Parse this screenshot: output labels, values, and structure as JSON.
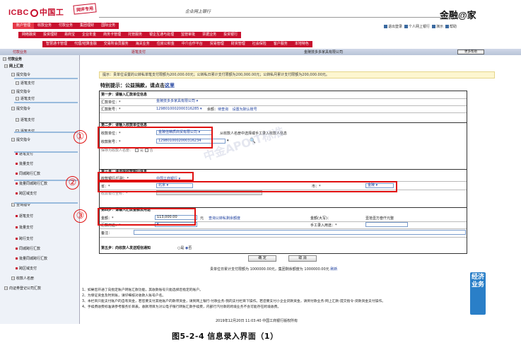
{
  "header": {
    "logo_text": "ICBC",
    "logo_cn": "中国工",
    "stamp": "网评专用",
    "ebank_title": "企业网上银行",
    "brand": "金融@家"
  },
  "menu_row1": [
    "账户管理",
    "收款业务",
    "付款业务",
    "集团理财",
    "国际业务"
  ],
  "menu_row2": [
    "网络融资",
    "投资理财",
    "易商宝",
    "企业年金",
    "商务卡管理",
    "托管服务",
    "银企互通与处理",
    "监管审批",
    "票据业务",
    "投资银行"
  ],
  "menu_row3": [
    "智慧通卡管理",
    "代理/结算金融",
    "交易所会员服务",
    "海关业务",
    "住房公积金",
    "中介合作平台",
    "贸易管理",
    "财资管理",
    "社会保险",
    "客户服务",
    "本地特色"
  ],
  "top_links": [
    "退出登录",
    "个人网上银行",
    "演示",
    "帮助"
  ],
  "navbar": {
    "left": "付款业务",
    "center": "逐笔支付",
    "company": "金陵技多多家具有限公司",
    "more_button": "更多帮助"
  },
  "sidebar": {
    "items": [
      "付款业务",
      "网上汇款",
      "提交指令",
      "逐笔支付",
      "提交指令",
      "逐笔支付",
      "提交指令",
      "逐笔支付",
      "逐笔支付",
      "提交指令",
      "逐笔支付",
      "批量支付",
      "同城跨行汇款",
      "批量同城跨行汇款",
      "跨区域支付",
      "查询指令",
      "逐笔支付",
      "批量支付",
      "跨行支付",
      "同城跨行汇款",
      "批量同城跨行汇款",
      "跨区域支付",
      "收款人名册",
      "向证券登记公司汇款"
    ]
  },
  "tip": "提示：贵单位设置的公转私单笔支付限额为200,000.00元；公转私日累计支付限额为200,000.00元；公转私月累计支付限额为200,000.00元。",
  "special": {
    "prefix": "特别提示：公益捐款，请点击",
    "link": "这里"
  },
  "form": {
    "step1": "第一步：请输入汇款单位信息",
    "payer_label": "汇款单位：*",
    "payer_value": "金陵技多多家具有限公司",
    "payer_account_label": "汇款账号：*",
    "payer_account_value": "1298010002000316285",
    "balance_label": "余额：",
    "balance_link": "待查询",
    "default_link": "设置为默认账号",
    "step2": "第二步：请输入收款单位信息",
    "payee_label": "收款单位：*",
    "payee_value": "金陵佳精质商贸有限公司",
    "payee_hint": "从收款人名册中选择或手工录入收款人信息",
    "payee_account_label": "收款账号：*",
    "payee_account_value": "1298010002000316234",
    "save_label": "保存为收款人名册：",
    "save_opts": [
      "是",
      "否"
    ],
    "step3": "第三步：请选择收款银行信息",
    "bank_label": "收款银行/行别：*",
    "bank_value": "中国工商银行",
    "province_label": "省：*",
    "province_value": "北京",
    "city_label": "市：*",
    "city_value": "金陵",
    "branch_label": "收款银行全称：*",
    "step4": "第四步：请输入汇款金额及用途",
    "amount_label": "金额：*",
    "amount_value": "113,000.00",
    "amount_unit": "元",
    "query_link": "查询公转私剩余额度",
    "upper_label": "金额(大写)：",
    "upper_value": "壹拾壹万叁仟元整",
    "purpose_label": "汇款用途：*",
    "manual_label": "手工录入用途：*",
    "remark_label": "备注：",
    "step5": "第五步：向收款人发送短信通知",
    "yes": "是",
    "no": "否",
    "ok_button": "确 定",
    "cancel_button": "取 消",
    "limit_text": "贵单位日累计支付限额为 1000000.00元，集团剩余额度为 1000000.00元",
    "refresh_link": "刷新"
  },
  "markers": [
    "①",
    "②",
    "③"
  ],
  "watermark": "中金APOIT标准",
  "notes": [
    "1、如果您开通了向指定账户转账汇款功能，其收款账号只能选择您指定的账户。",
    "2、为保证资金及时到账，请仔细核对收款人账号户名。",
    "3、本栏目只能支付账户的自有资金，若您要支付其他账户的款项资金，请到网上银行-付款业务-我的支付栏目下操作。若您要支付小企业贷款资金，请到付款业务-网上汇款-提交指令-贷款资金支付操作。",
    "4、手续费收费标准请参考服务价目表。收款项目为对公电子银行转账汇款手续费，内部行汽付款的跨境业务不会可能存在跨境收费。"
  ],
  "footer": "2019年12月20日 11:03:40 中国工商银行版权所有",
  "consult": "经济业务",
  "caption": "图5-2-4 信息录入界面（1）"
}
